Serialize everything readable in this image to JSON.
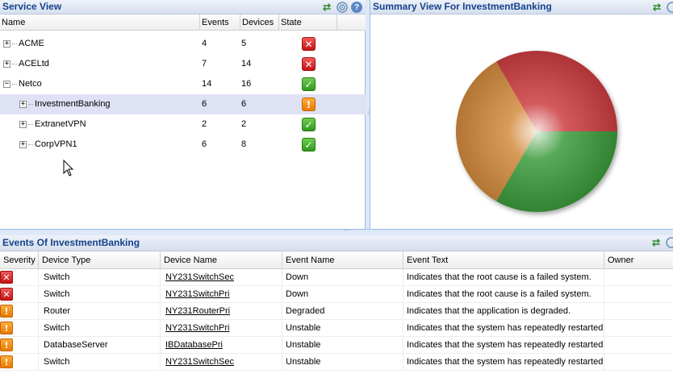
{
  "service_view": {
    "title": "Service View",
    "columns": [
      "Name",
      "Events",
      "Devices",
      "State"
    ],
    "rows": [
      {
        "name": "ACME",
        "events": "4",
        "devices": "5",
        "state": "critical",
        "expander": "+",
        "level": 0,
        "selected": false
      },
      {
        "name": "ACELtd",
        "events": "7",
        "devices": "14",
        "state": "critical",
        "expander": "+",
        "level": 0,
        "selected": false
      },
      {
        "name": "Netco",
        "events": "14",
        "devices": "16",
        "state": "ok",
        "expander": "−",
        "level": 0,
        "selected": false
      },
      {
        "name": "InvestmentBanking",
        "events": "6",
        "devices": "6",
        "state": "warning",
        "expander": "+",
        "level": 1,
        "selected": true
      },
      {
        "name": "ExtranetVPN",
        "events": "2",
        "devices": "2",
        "state": "ok",
        "expander": "+",
        "level": 1,
        "selected": false
      },
      {
        "name": "CorpVPN1",
        "events": "6",
        "devices": "8",
        "state": "ok",
        "expander": "+",
        "level": 1,
        "selected": false
      }
    ]
  },
  "summary_view": {
    "title": "Summary View For InvestmentBanking",
    "pie": [
      {
        "label": "critical",
        "value": 2,
        "color": "#cc3d40"
      },
      {
        "label": "ok",
        "value": 2,
        "color": "#3a9a3a"
      },
      {
        "label": "warning",
        "value": 2,
        "color": "#d28a3c"
      }
    ]
  },
  "events_view": {
    "title": "Events Of InvestmentBanking",
    "columns": [
      "Severity",
      "Device Type",
      "Device Name",
      "Event Name",
      "Event Text",
      "Owner"
    ],
    "rows": [
      {
        "severity": "critical",
        "device_type": "Switch",
        "device_name": "NY231SwitchSec",
        "event_name": "Down",
        "event_text": "Indicates that the root cause is a failed system.",
        "owner": ""
      },
      {
        "severity": "critical",
        "device_type": "Switch",
        "device_name": "NY231SwitchPri",
        "event_name": "Down",
        "event_text": "Indicates that the root cause is a failed system.",
        "owner": ""
      },
      {
        "severity": "warning",
        "device_type": "Router",
        "device_name": "NY231RouterPri",
        "event_name": "Degraded",
        "event_text": "Indicates that the application is degraded.",
        "owner": ""
      },
      {
        "severity": "warning",
        "device_type": "Switch",
        "device_name": "NY231SwitchPri",
        "event_name": "Unstable",
        "event_text": "Indicates that the system has repeatedly restarted",
        "owner": ""
      },
      {
        "severity": "warning",
        "device_type": "DatabaseServer",
        "device_name": "IBDatabasePri",
        "event_name": "Unstable",
        "event_text": "Indicates that the system has repeatedly restarted",
        "owner": ""
      },
      {
        "severity": "warning",
        "device_type": "Switch",
        "device_name": "NY231SwitchSec",
        "event_name": "Unstable",
        "event_text": "Indicates that the system has repeatedly restarted",
        "owner": ""
      }
    ]
  },
  "icons": {
    "critical": "✕",
    "ok": "✓",
    "warning": "!",
    "refresh": "⇄",
    "help": "?"
  },
  "colors": {
    "header_text": "#15428b",
    "selected_row": "#dfe1f5"
  }
}
